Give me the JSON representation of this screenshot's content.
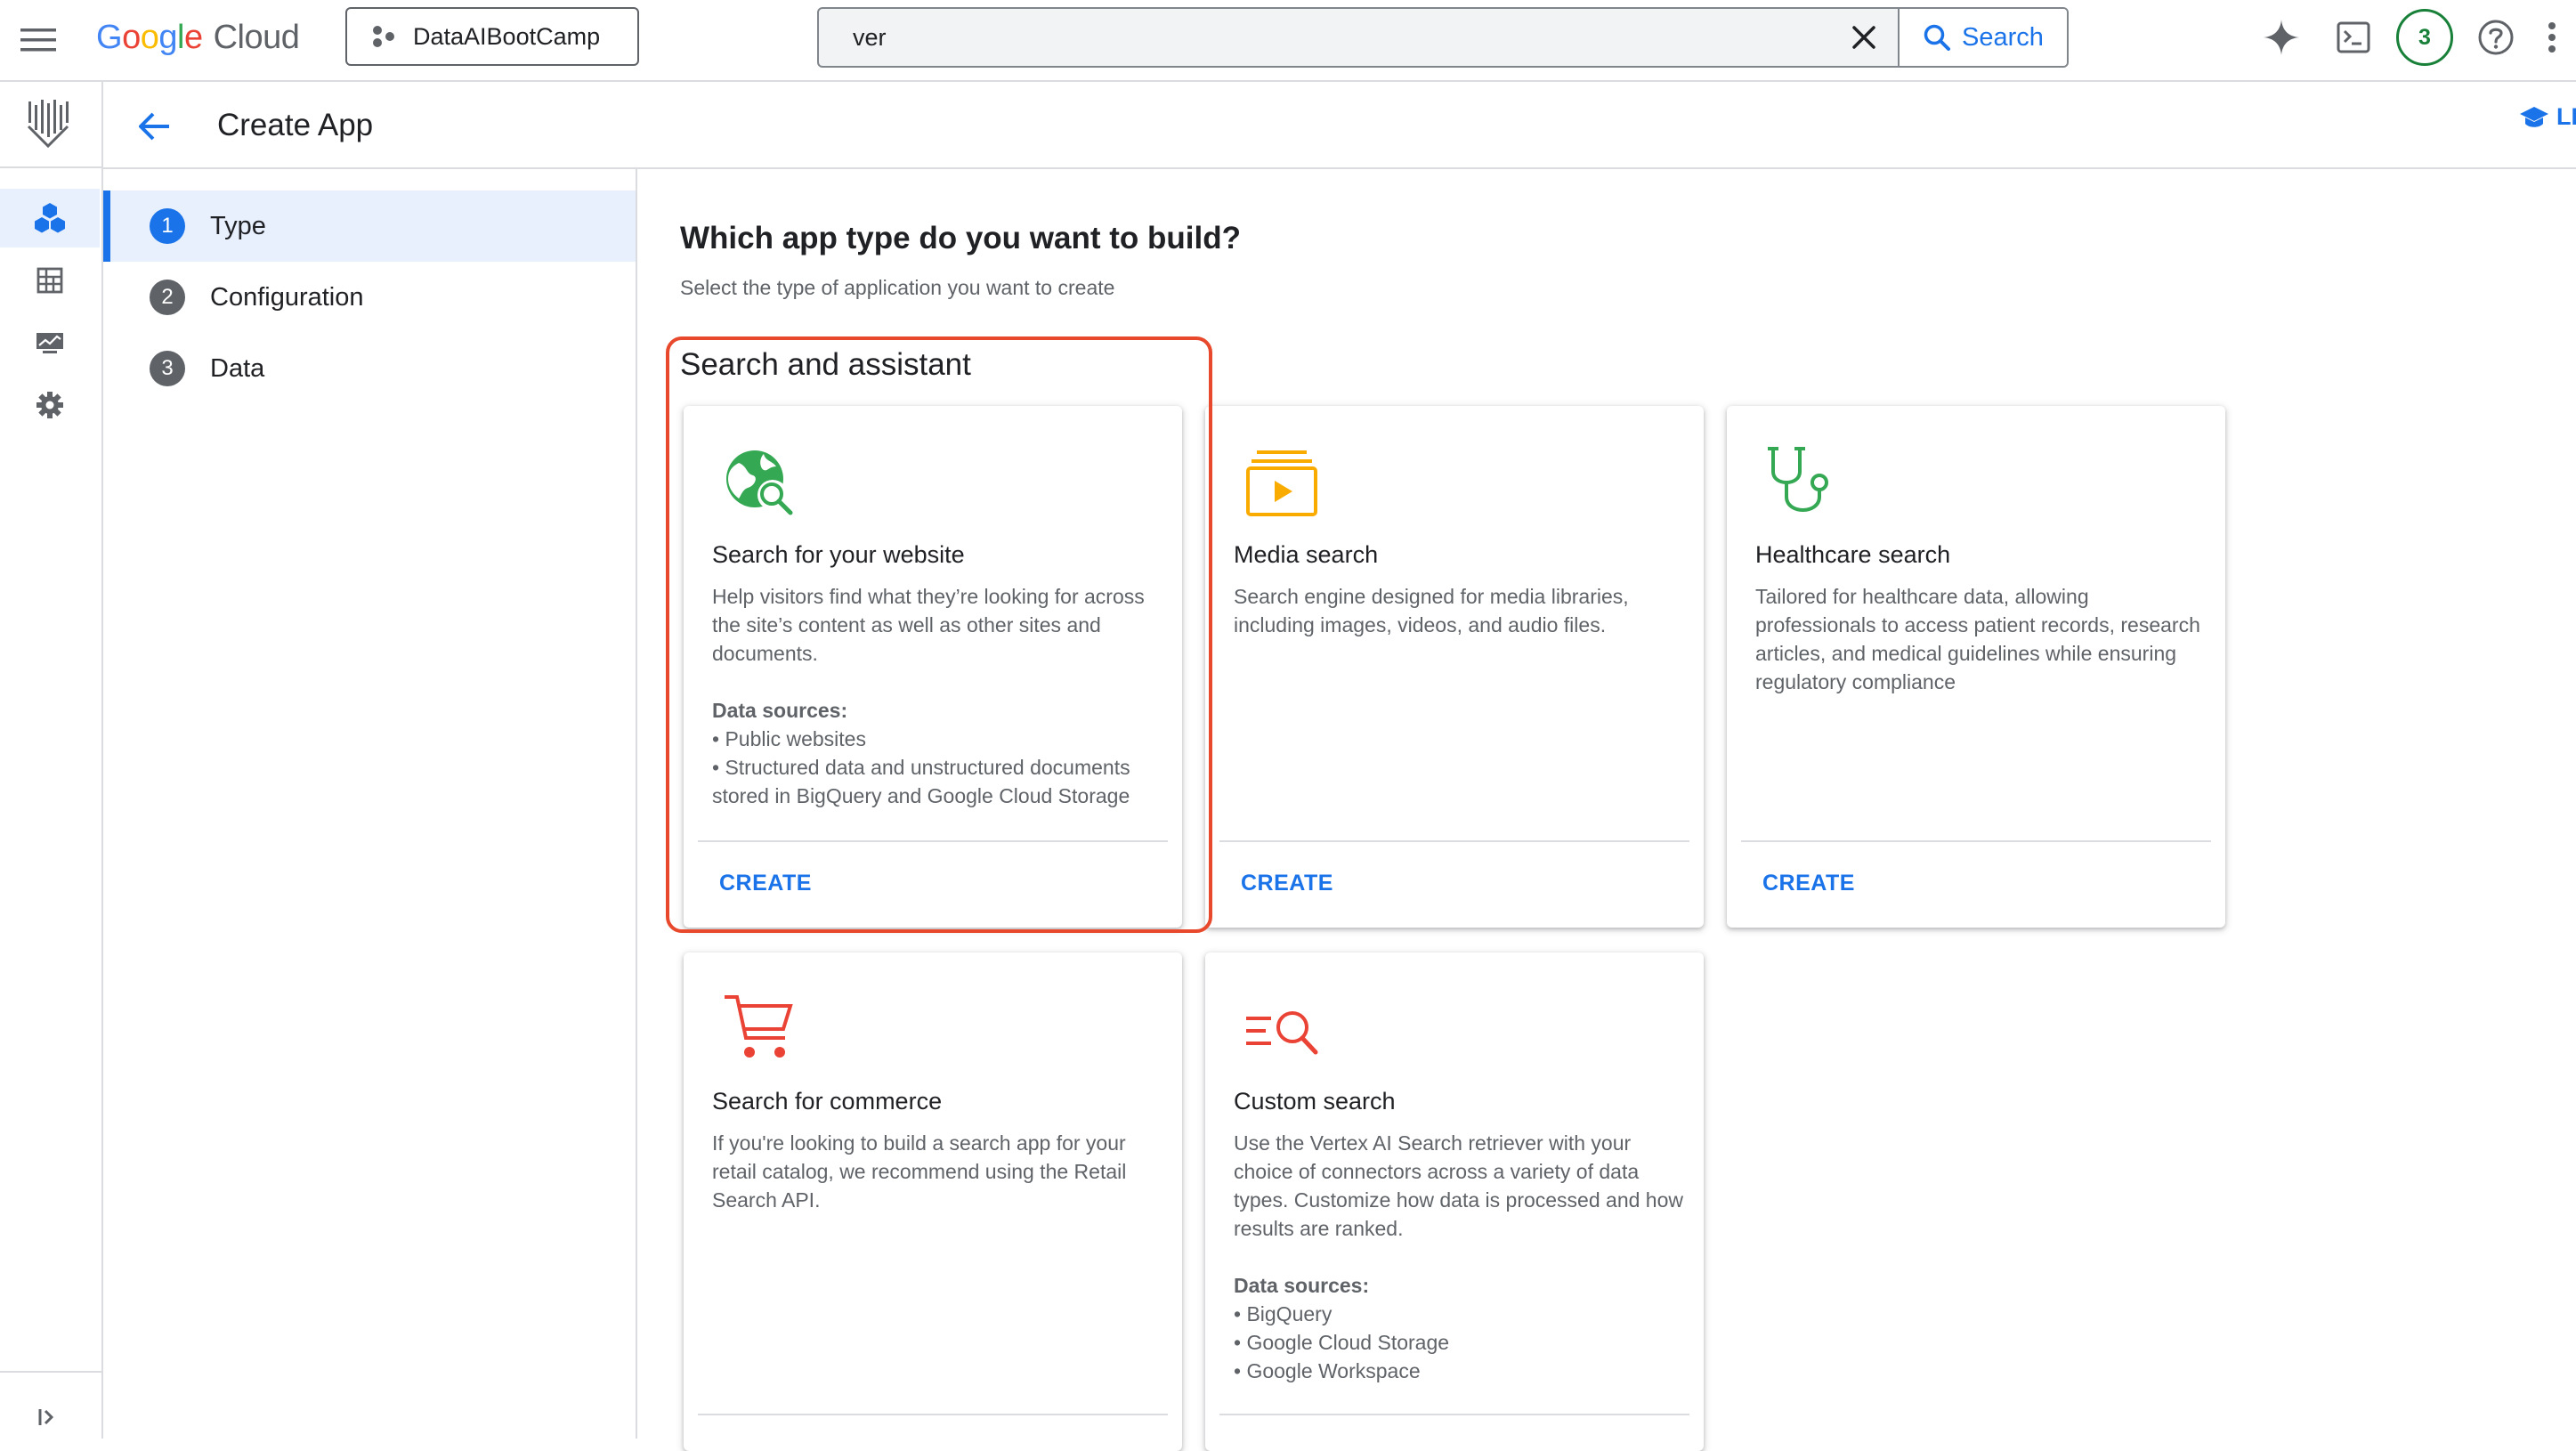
{
  "topbar": {
    "logo_google": "Google",
    "logo_cloud": "Cloud",
    "project": "DataAIBootCamp",
    "search_value": "ver",
    "search_button": "Search",
    "notifications_count": "3"
  },
  "header": {
    "title": "Create App",
    "learn_label": "LE"
  },
  "stepper": {
    "steps": [
      {
        "num": "1",
        "label": "Type"
      },
      {
        "num": "2",
        "label": "Configuration"
      },
      {
        "num": "3",
        "label": "Data"
      }
    ]
  },
  "content": {
    "title": "Which app type do you want to build?",
    "subtitle": "Select the type of application you want to create",
    "section": "Search and assistant"
  },
  "cards": {
    "website": {
      "title": "Search for your website",
      "desc": "Help visitors find what they’re looking for across the site’s content as well as other sites and documents.",
      "ds_title": "Data sources:",
      "ds_1": "• Public websites",
      "ds_2": "• Structured data and unstructured documents stored in BigQuery and Google Cloud Storage",
      "create": "CREATE"
    },
    "media": {
      "title": "Media search",
      "desc": "Search engine designed for media libraries, including images, videos, and audio files.",
      "create": "CREATE"
    },
    "health": {
      "title": "Healthcare search",
      "desc": "Tailored for healthcare data, allowing professionals to access patient records, research articles, and medical guidelines while ensuring regulatory compliance",
      "create": "CREATE"
    },
    "commerce": {
      "title": "Search for commerce",
      "desc": "If you're looking to build a search app for your retail catalog, we recommend using the Retail Search API."
    },
    "custom": {
      "title": "Custom search",
      "desc": "Use the Vertex AI Search retriever with your choice of connectors across a variety of data types. Customize how data is processed and how results are ranked.",
      "ds_title": "Data sources:",
      "ds_1": "• BigQuery",
      "ds_2": "• Google Cloud Storage",
      "ds_3": "• Google Workspace"
    }
  },
  "colors": {
    "accent": "#1a73e8",
    "highlight": "#e8492c",
    "green": "#188038",
    "media_orange": "#f9ab00",
    "commerce_red": "#ea4335"
  }
}
